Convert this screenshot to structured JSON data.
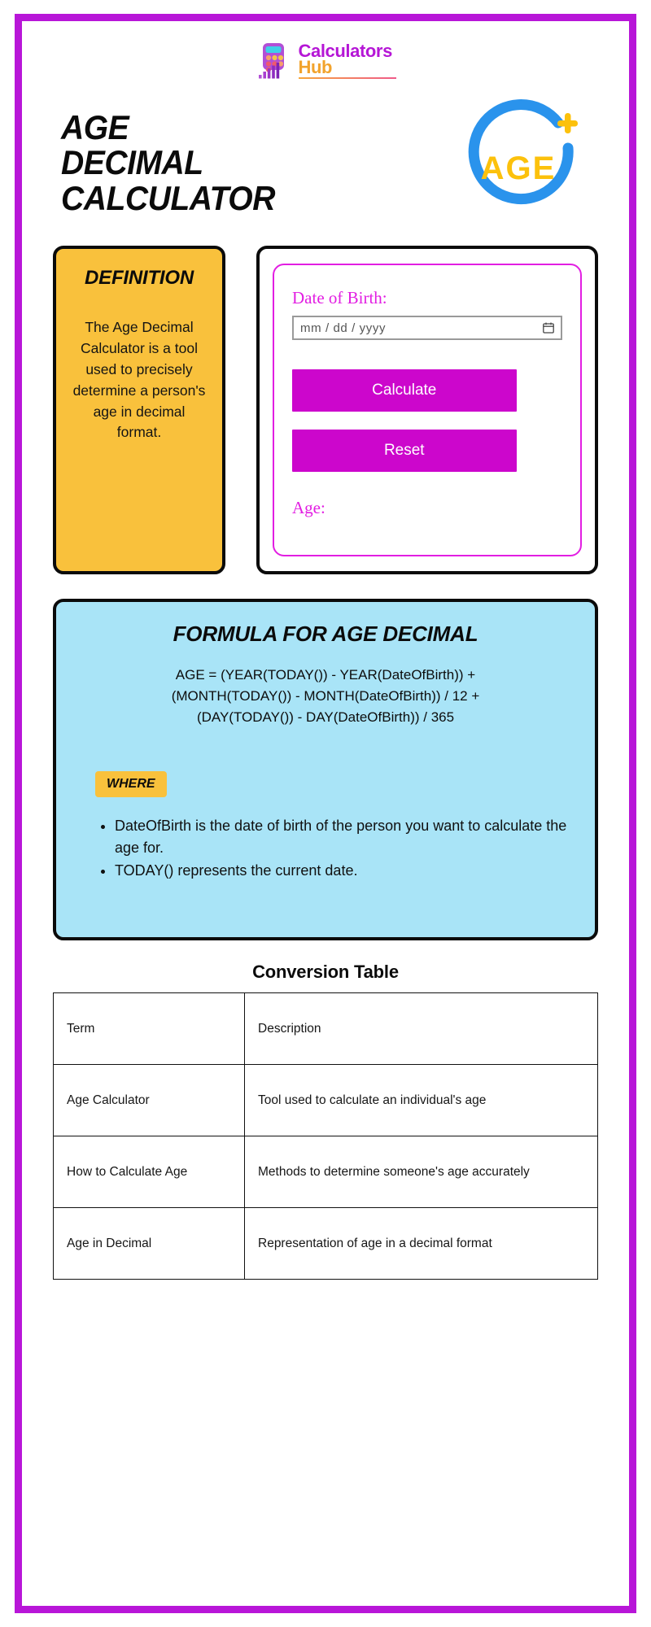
{
  "brand": {
    "logo_icon": "calculator-bar-chart-icon",
    "line1": "Calculators",
    "line2": "Hub"
  },
  "hero": {
    "title_line1": "AGE",
    "title_line2": "DECIMAL",
    "title_line3": "CALCULATOR",
    "badge_text": "AGE",
    "badge_plus": "+",
    "badge_ring_color": "#2a93ec",
    "badge_text_color": "#fcc10c"
  },
  "definition": {
    "heading": "DEFINITION",
    "body": "The Age Decimal Calculator is a tool used to precisely determine a person's age in decimal format.",
    "bg_color": "#f9c13c"
  },
  "calculator": {
    "dob_label": "Date of Birth:",
    "dob_placeholder": "mm / dd / yyyy",
    "dob_value": "",
    "calendar_icon": "calendar-icon",
    "calculate_label": "Calculate",
    "reset_label": "Reset",
    "result_label": "Age:",
    "result_value": "",
    "accent_color": "#cc06cc"
  },
  "formula": {
    "heading": "FORMULA FOR AGE DECIMAL",
    "equation_lines": [
      "AGE = (YEAR(TODAY()) - YEAR(DateOfBirth)) +",
      "(MONTH(TODAY()) - MONTH(DateOfBirth)) / 12 +",
      "(DAY(TODAY()) - DAY(DateOfBirth)) / 365"
    ],
    "where_label": "WHERE",
    "where_items": [
      "DateOfBirth is the date of birth of the person you want to calculate the age for.",
      "TODAY() represents the current date."
    ],
    "bg_color": "#a9e4f7"
  },
  "table": {
    "title": "Conversion Table",
    "headers": [
      "Term",
      "Description"
    ],
    "rows": [
      [
        "Age Calculator",
        "Tool used to calculate an individual's age"
      ],
      [
        "How to Calculate Age",
        "Methods to determine someone's age accurately"
      ],
      [
        "Age in Decimal",
        "Representation of age in a decimal format"
      ]
    ]
  },
  "theme": {
    "border_color": "#b816d8"
  }
}
